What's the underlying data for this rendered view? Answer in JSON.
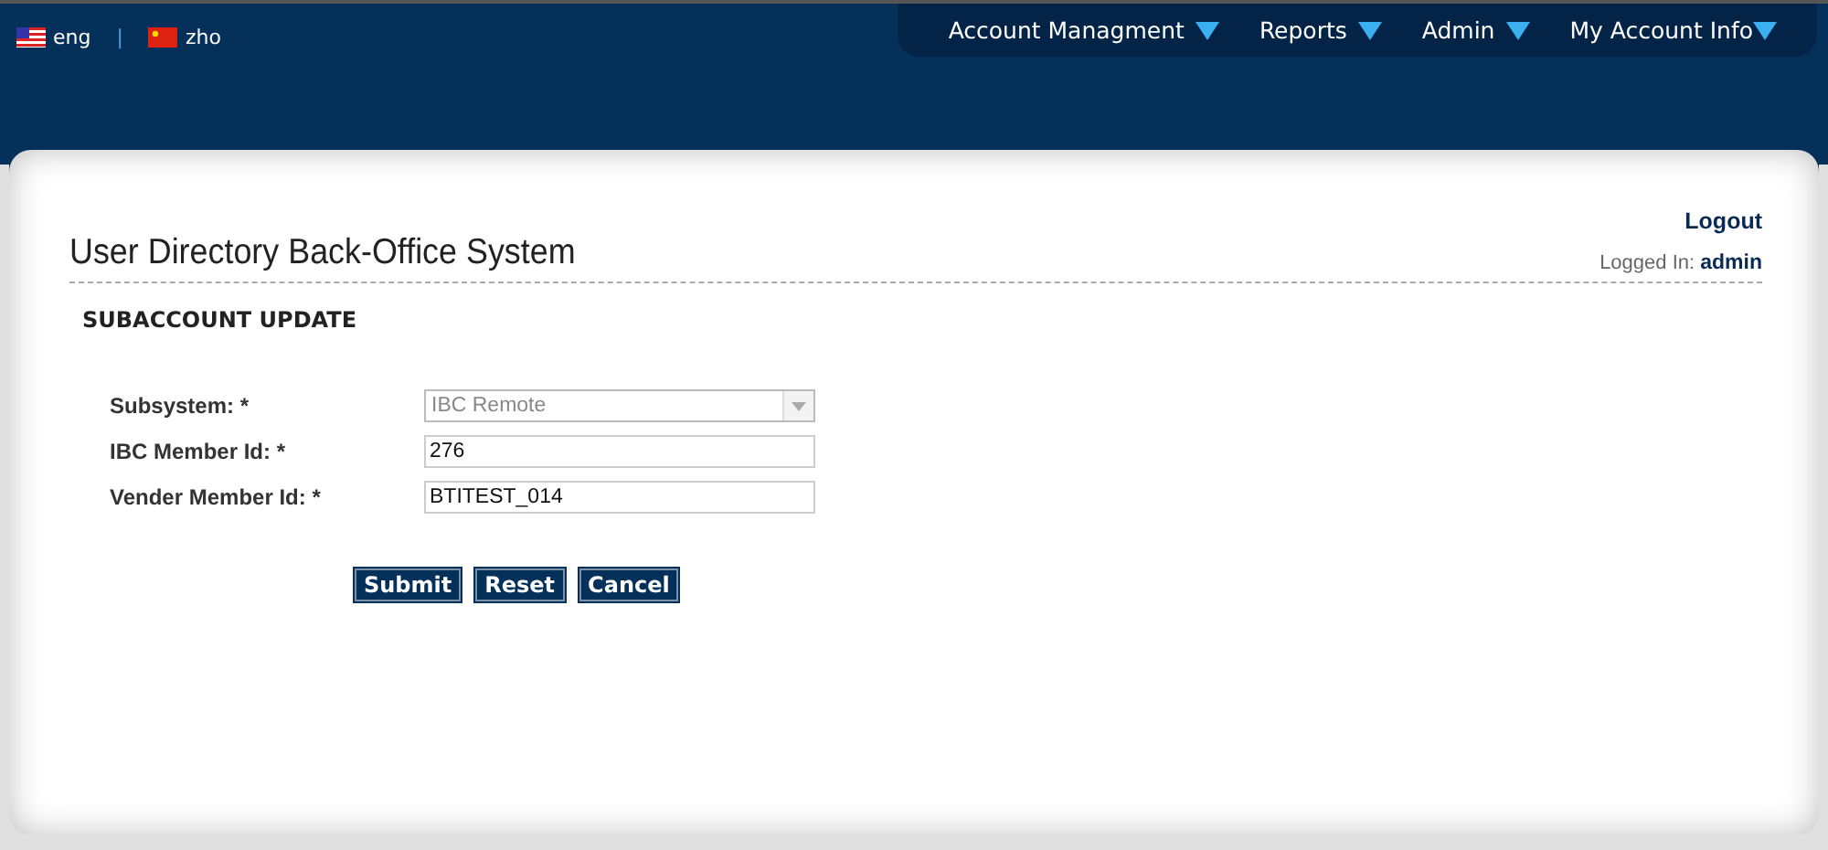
{
  "languages": [
    {
      "label": "eng",
      "kind": "us"
    },
    {
      "label": "zho",
      "kind": "cn"
    }
  ],
  "language_separator": "|",
  "nav": [
    {
      "label": "Account Managment"
    },
    {
      "label": "Reports"
    },
    {
      "label": "Admin"
    },
    {
      "label": "My Account Info"
    }
  ],
  "header": {
    "title": "User Directory Back-Office System",
    "logout": "Logout",
    "logged_in_label": "Logged In:",
    "logged_in_user": "admin"
  },
  "section_title": "SUBACCOUNT UPDATE",
  "form": {
    "fields": [
      {
        "label": "Subsystem: *",
        "kind": "select",
        "value": "IBC Remote",
        "disabled": true
      },
      {
        "label": "IBC Member Id: *",
        "kind": "text",
        "value": "276",
        "disabled": false
      },
      {
        "label": "Vender Member Id: *",
        "kind": "text",
        "value": "BTITEST_014",
        "disabled": false
      }
    ]
  },
  "buttons": [
    "Submit",
    "Reset",
    "Cancel"
  ]
}
